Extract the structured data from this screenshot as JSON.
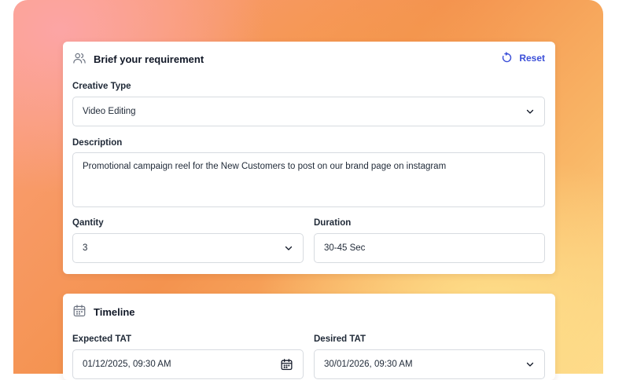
{
  "brief": {
    "title": "Brief your requirement",
    "reset_label": "Reset",
    "creative_type": {
      "label": "Creative Type",
      "value": "Video Editing"
    },
    "description": {
      "label": "Description",
      "value": "Promotional campaign reel for the New Customers to post on our brand page on instagram"
    },
    "quantity": {
      "label": "Qantity",
      "value": "3"
    },
    "duration": {
      "label": "Duration",
      "value": "30-45 Sec"
    }
  },
  "timeline": {
    "title": "Timeline",
    "expected_tat": {
      "label": "Expected TAT",
      "value": "01/12/2025, 09:30 AM"
    },
    "desired_tat": {
      "label": "Desired TAT",
      "value": "30/01/2026, 09:30 AM"
    }
  },
  "colors": {
    "accent": "#3b4fd8",
    "border": "#d7dbe0",
    "text": "#1f2937"
  },
  "icons": {
    "brief": "users-icon",
    "reset": "refresh-icon",
    "timeline": "calendar-icon",
    "dropdown": "chevron-down-icon"
  }
}
